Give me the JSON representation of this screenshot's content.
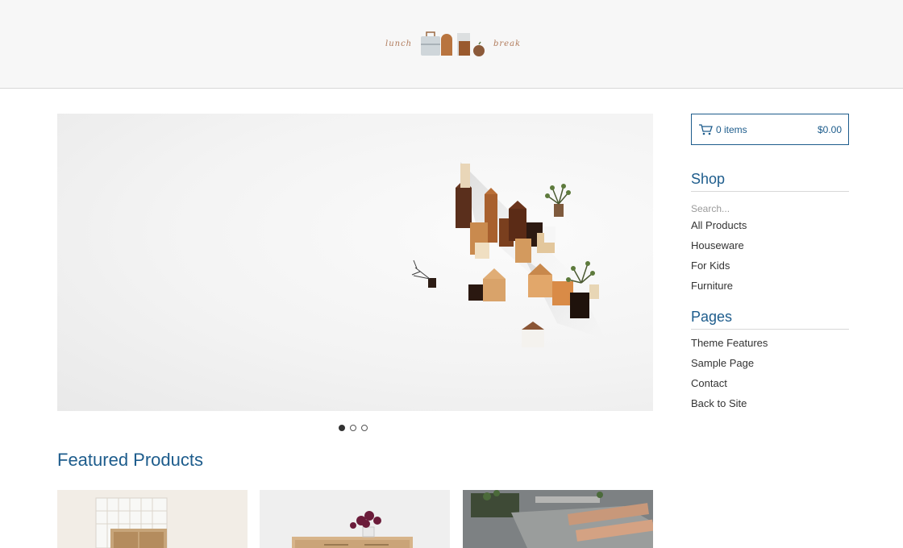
{
  "header": {
    "logo_left": "lunch",
    "logo_right": "break"
  },
  "hero": {
    "image": "wooden-house-figurines-photo",
    "slides": 3,
    "active_slide": 1
  },
  "featured": {
    "title": "Featured Products",
    "products": [
      {
        "image": "wooden-cabinet-photo"
      },
      {
        "image": "wooden-dresser-with-flowers-photo"
      },
      {
        "image": "wooden-planter-boxes-photo"
      }
    ]
  },
  "cart": {
    "items": "0 items",
    "total": "$0.00",
    "icon": "cart-icon"
  },
  "shop": {
    "title": "Shop",
    "search_placeholder": "Search...",
    "items": [
      "All Products",
      "Houseware",
      "For Kids",
      "Furniture"
    ]
  },
  "pages": {
    "title": "Pages",
    "items": [
      "Theme Features",
      "Sample Page",
      "Contact",
      "Back to Site"
    ]
  },
  "colors": {
    "accent": "#1d5c8c",
    "header_bg": "#f7f7f7"
  }
}
